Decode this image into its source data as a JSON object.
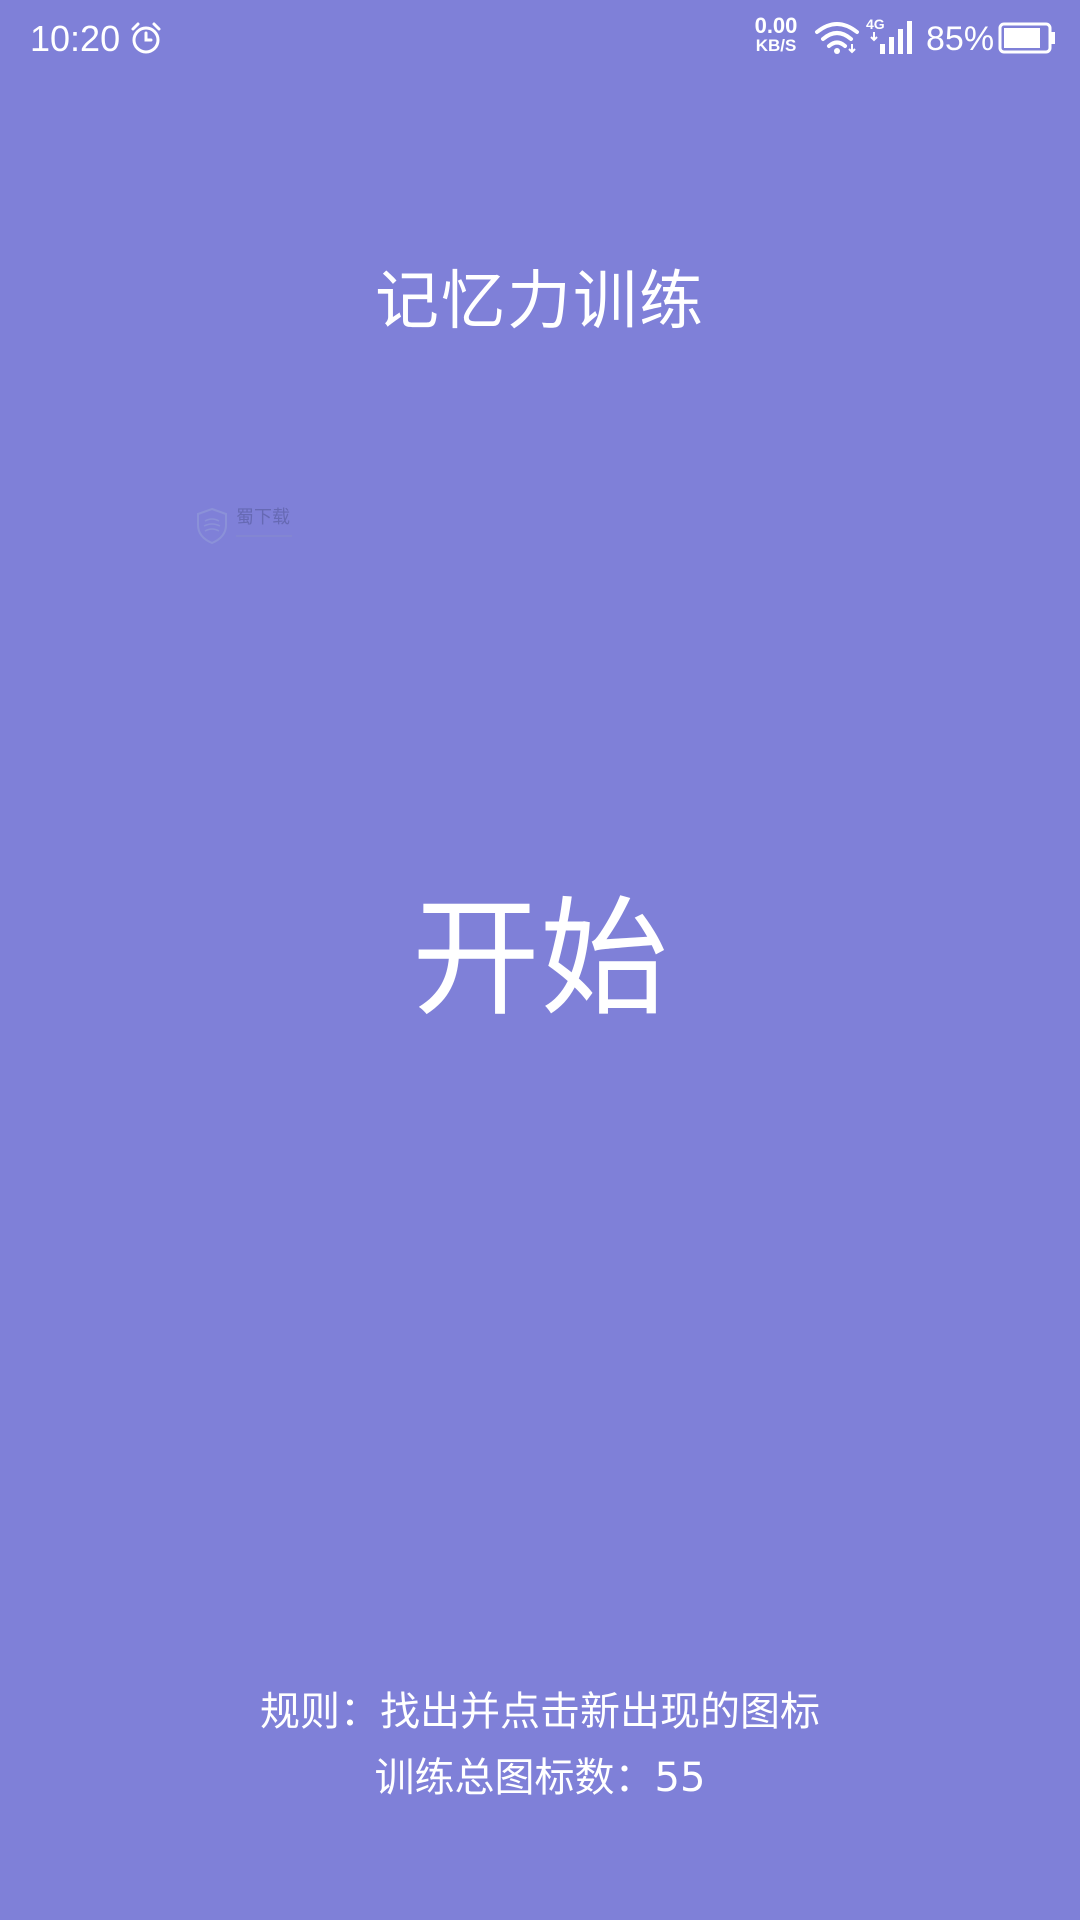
{
  "status_bar": {
    "time": "10:20",
    "net_speed_value": "0.00",
    "net_speed_unit": "KB/S",
    "signal_type": "4G",
    "battery_percent": "85%",
    "battery_level": 0.85
  },
  "main": {
    "title": "记忆力训练",
    "start_label": "开始",
    "rules": "规则：找出并点击新出现的图标",
    "total_icons": "训练总图标数：55"
  },
  "watermark": {
    "text": "蜀下载"
  },
  "colors": {
    "background": "#7F80D8",
    "text": "#FFFFFF"
  }
}
